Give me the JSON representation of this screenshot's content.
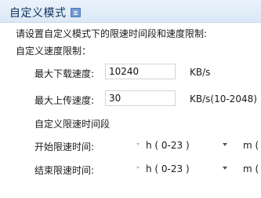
{
  "header": {
    "title": "自定义模式",
    "icon": "collapse-icon"
  },
  "intro": "请设置自定义模式下的限速时间段和速度限制:",
  "speed_section": {
    "title": "自定义速度限制：",
    "download": {
      "label": "最大下载速度:",
      "value": "10240",
      "unit": "KB/s"
    },
    "upload": {
      "label": "最大上传速度:",
      "value": "30",
      "unit": "KB/s(10-2048)"
    }
  },
  "time_section": {
    "title": "自定义限速时间段",
    "start": {
      "label": "开始限速时间:",
      "hour_unit": "h ( 0-23 )",
      "minute_unit": "m ("
    },
    "end": {
      "label": "结束限速时间:",
      "hour_unit": "h ( 0-23 )",
      "minute_unit": "m ("
    }
  },
  "colors": {
    "header_bg": "#dbe8f6",
    "header_text": "#10335c",
    "input_border": "#d5d5d5"
  }
}
